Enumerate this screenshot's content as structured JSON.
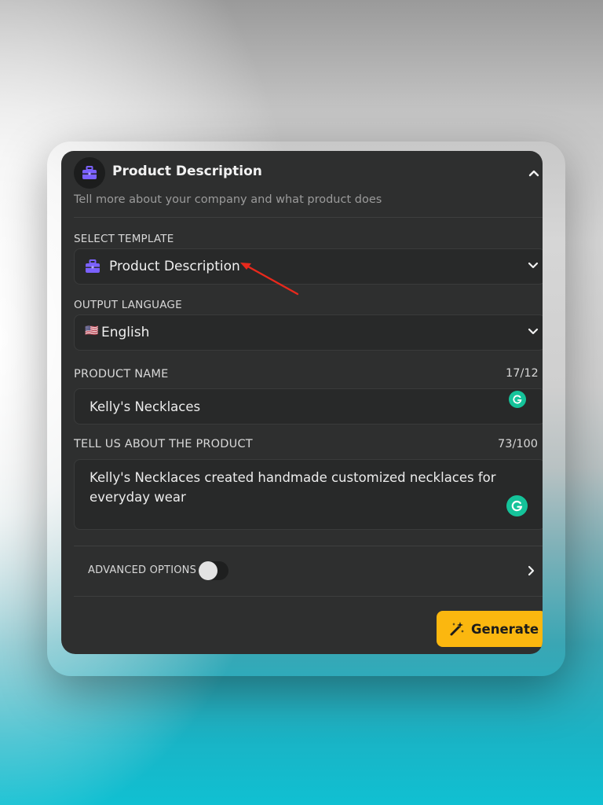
{
  "colors": {
    "card_bg": "#2e2f2f",
    "field_bg": "#282929",
    "accent_purple": "#7b61ff",
    "generate_bg": "#fbb70f",
    "grammarly_green": "#15c39a",
    "annotation_arrow": "#e8291c"
  },
  "header": {
    "icon": "briefcase-icon",
    "title": "Product Description",
    "subtitle": "Tell more about your company and what product does",
    "collapse_icon": "chevron-up-icon"
  },
  "template": {
    "label": "SELECT TEMPLATE",
    "icon": "briefcase-icon",
    "value": "Product Description"
  },
  "language": {
    "label": "OUTPUT LANGUAGE",
    "flag": "🇺🇸",
    "value": "English"
  },
  "product_name": {
    "label": "PRODUCT NAME",
    "counter": "17/12",
    "value": "Kelly's Necklaces"
  },
  "product_about": {
    "label": "TELL US ABOUT THE PRODUCT",
    "counter": "73/100",
    "line1": "Kelly's Necklaces created handmade customized necklaces for",
    "line2": "everyday wear"
  },
  "advanced": {
    "label": "ADVANCED OPTIONS",
    "enabled": false
  },
  "generate": {
    "label": "Generate",
    "icon": "magic-wand-icon"
  }
}
